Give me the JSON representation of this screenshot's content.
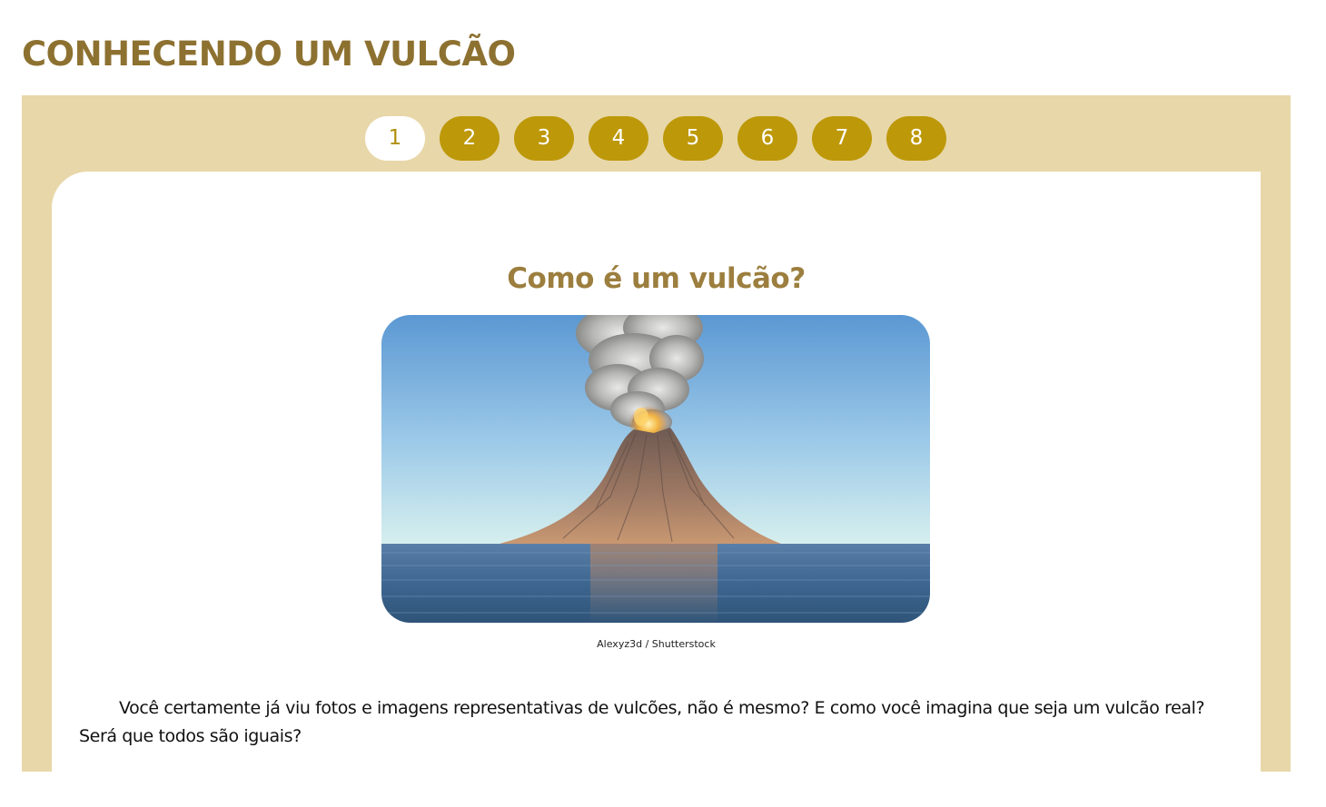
{
  "page": {
    "title": "CONHECENDO UM VULCÃO"
  },
  "tabs": [
    {
      "label": "1",
      "active": true
    },
    {
      "label": "2",
      "active": false
    },
    {
      "label": "3",
      "active": false
    },
    {
      "label": "4",
      "active": false
    },
    {
      "label": "5",
      "active": false
    },
    {
      "label": "6",
      "active": false
    },
    {
      "label": "7",
      "active": false
    },
    {
      "label": "8",
      "active": false
    }
  ],
  "content": {
    "heading": "Como é um vulcão?",
    "image_credit": "Alexyz3d / Shutterstock",
    "paragraph": "Você certamente já viu fotos e imagens representativas de vulcões, não é mesmo? E como você imagina que seja um vulcão real? Será que todos são iguais?"
  },
  "colors": {
    "title": "#8d7130",
    "panel_background": "#e8d7a9",
    "tab_background": "#bd9809",
    "tab_active_background": "#ffffff",
    "heading": "#9c7e3e"
  }
}
